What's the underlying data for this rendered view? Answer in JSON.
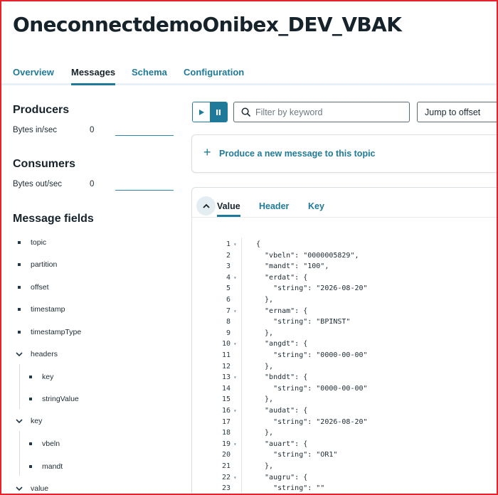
{
  "page": {
    "title": "OneconnectdemoOnibex_DEV_VBAK"
  },
  "tabs": [
    {
      "label": "Overview",
      "active": false
    },
    {
      "label": "Messages",
      "active": true
    },
    {
      "label": "Schema",
      "active": false
    },
    {
      "label": "Configuration",
      "active": false
    }
  ],
  "sidebar": {
    "producers": {
      "heading": "Producers",
      "metric_label": "Bytes in/sec",
      "metric_value": "0"
    },
    "consumers": {
      "heading": "Consumers",
      "metric_label": "Bytes out/sec",
      "metric_value": "0"
    },
    "message_fields": {
      "heading": "Message fields",
      "fields": [
        {
          "label": "topic",
          "kind": "leaf"
        },
        {
          "label": "partition",
          "kind": "leaf"
        },
        {
          "label": "offset",
          "kind": "leaf"
        },
        {
          "label": "timestamp",
          "kind": "leaf"
        },
        {
          "label": "timestampType",
          "kind": "leaf"
        },
        {
          "label": "headers",
          "kind": "group-expanded"
        },
        {
          "label": "key",
          "kind": "child"
        },
        {
          "label": "stringValue",
          "kind": "child"
        },
        {
          "label": "key",
          "kind": "group-expanded"
        },
        {
          "label": "vbeln",
          "kind": "child"
        },
        {
          "label": "mandt",
          "kind": "child"
        },
        {
          "label": "value",
          "kind": "group-expanded"
        }
      ]
    }
  },
  "toolbar": {
    "play_icon": "play-icon",
    "pause_icon": "pause-icon",
    "filter_placeholder": "Filter by keyword",
    "jump_label": "Jump to offset"
  },
  "produce": {
    "label": "Produce a new message to this topic"
  },
  "message": {
    "view_tabs": [
      {
        "label": "Value",
        "active": true
      },
      {
        "label": "Header",
        "active": false
      },
      {
        "label": "Key",
        "active": false
      }
    ],
    "code_lines": [
      {
        "n": "1",
        "fold": true,
        "text": "{"
      },
      {
        "n": "2",
        "fold": false,
        "text": "  \"vbeln\": \"0000005829\","
      },
      {
        "n": "3",
        "fold": false,
        "text": "  \"mandt\": \"100\","
      },
      {
        "n": "4",
        "fold": true,
        "text": "  \"erdat\": {"
      },
      {
        "n": "5",
        "fold": false,
        "text": "    \"string\": \"2026-08-20\""
      },
      {
        "n": "6",
        "fold": false,
        "text": "  },"
      },
      {
        "n": "7",
        "fold": true,
        "text": "  \"ernam\": {"
      },
      {
        "n": "8",
        "fold": false,
        "text": "    \"string\": \"BPINST\""
      },
      {
        "n": "9",
        "fold": false,
        "text": "  },"
      },
      {
        "n": "10",
        "fold": true,
        "text": "  \"angdt\": {"
      },
      {
        "n": "11",
        "fold": false,
        "text": "    \"string\": \"0000-00-00\""
      },
      {
        "n": "12",
        "fold": false,
        "text": "  },"
      },
      {
        "n": "13",
        "fold": true,
        "text": "  \"bnddt\": {"
      },
      {
        "n": "14",
        "fold": false,
        "text": "    \"string\": \"0000-00-00\""
      },
      {
        "n": "15",
        "fold": false,
        "text": "  },"
      },
      {
        "n": "16",
        "fold": true,
        "text": "  \"audat\": {"
      },
      {
        "n": "17",
        "fold": false,
        "text": "    \"string\": \"2026-08-20\""
      },
      {
        "n": "18",
        "fold": false,
        "text": "  },"
      },
      {
        "n": "19",
        "fold": true,
        "text": "  \"auart\": {"
      },
      {
        "n": "20",
        "fold": false,
        "text": "    \"string\": \"OR1\""
      },
      {
        "n": "21",
        "fold": false,
        "text": "  },"
      },
      {
        "n": "22",
        "fold": true,
        "text": "  \"augru\": {"
      },
      {
        "n": "23",
        "fold": false,
        "text": "    \"string\": \"\""
      }
    ]
  },
  "colors": {
    "accent": "#1f7a99",
    "frame": "#e8222b",
    "text": "#16232b"
  }
}
